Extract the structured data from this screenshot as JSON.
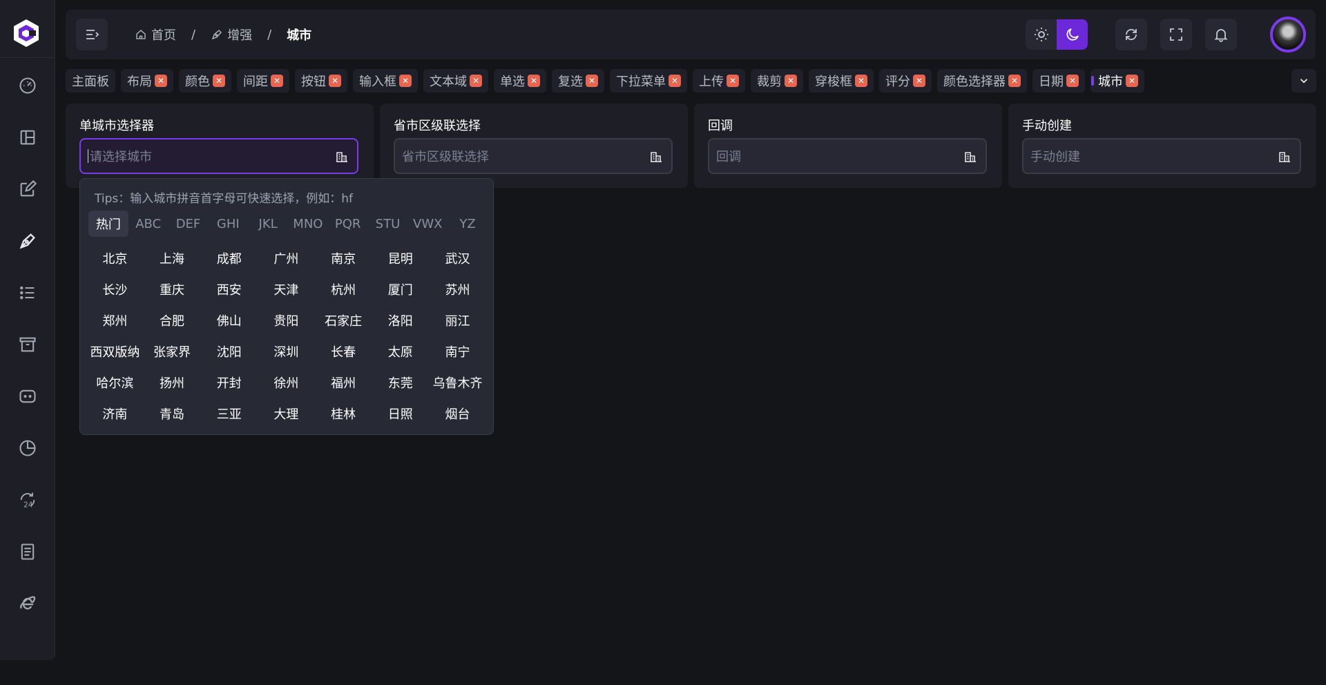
{
  "breadcrumb": {
    "home": "首页",
    "parent": "增强",
    "current": "城市"
  },
  "tabs": [
    {
      "label": "主面板",
      "closable": false
    },
    {
      "label": "布局",
      "closable": true
    },
    {
      "label": "颜色",
      "closable": true
    },
    {
      "label": "间距",
      "closable": true
    },
    {
      "label": "按钮",
      "closable": true
    },
    {
      "label": "输入框",
      "closable": true
    },
    {
      "label": "文本域",
      "closable": true
    },
    {
      "label": "单选",
      "closable": true
    },
    {
      "label": "复选",
      "closable": true
    },
    {
      "label": "下拉菜单",
      "closable": true
    },
    {
      "label": "上传",
      "closable": true
    },
    {
      "label": "裁剪",
      "closable": true
    },
    {
      "label": "穿梭框",
      "closable": true
    },
    {
      "label": "评分",
      "closable": true
    },
    {
      "label": "颜色选择器",
      "closable": true
    },
    {
      "label": "日期",
      "closable": true
    },
    {
      "label": "城市",
      "closable": true,
      "active": true
    }
  ],
  "tab_close_glyph": "✕",
  "cards": [
    {
      "title": "单城市选择器",
      "placeholder": "请选择城市"
    },
    {
      "title": "省市区级联选择",
      "placeholder": "省市区级联选择"
    },
    {
      "title": "回调",
      "placeholder": "回调"
    },
    {
      "title": "手动创建",
      "placeholder": "手动创建"
    }
  ],
  "dropdown": {
    "tips": "Tips：输入城市拼音首字母可快速选择，例如：hf",
    "letter_tabs": [
      "热门",
      "ABC",
      "DEF",
      "GHI",
      "JKL",
      "MNO",
      "PQR",
      "STU",
      "VWX",
      "YZ"
    ],
    "cities": [
      "北京",
      "上海",
      "成都",
      "广州",
      "南京",
      "昆明",
      "武汉",
      "长沙",
      "重庆",
      "西安",
      "天津",
      "杭州",
      "厦门",
      "苏州",
      "郑州",
      "合肥",
      "佛山",
      "贵阳",
      "石家庄",
      "洛阳",
      "丽江",
      "西双版纳",
      "张家界",
      "沈阳",
      "深圳",
      "长春",
      "太原",
      "南宁",
      "哈尔滨",
      "扬州",
      "开封",
      "徐州",
      "福州",
      "东莞",
      "乌鲁木齐",
      "济南",
      "青岛",
      "三亚",
      "大理",
      "桂林",
      "日照",
      "烟台"
    ]
  },
  "colors": {
    "accent": "#7c3aed",
    "close": "#e8664f",
    "bg": "#141519",
    "panel": "#1d1e26"
  }
}
